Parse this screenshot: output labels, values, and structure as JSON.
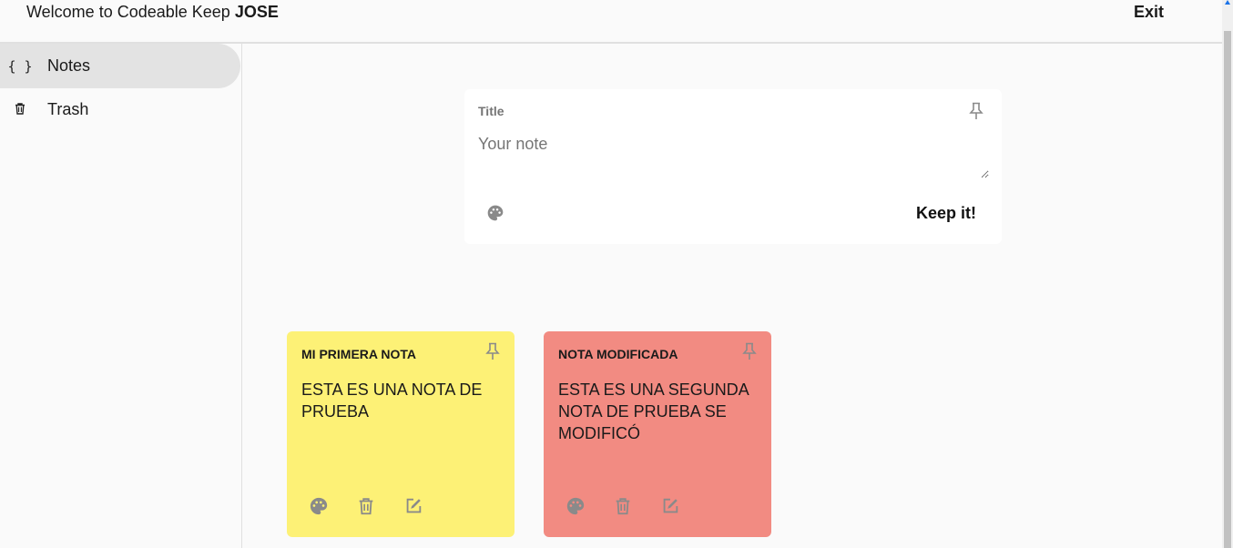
{
  "header": {
    "welcome_text": "Welcome to Codeable Keep ",
    "username": "JOSE",
    "exit_label": "Exit"
  },
  "sidebar": {
    "items": [
      {
        "label": "Notes",
        "icon": "braces-icon",
        "icon_glyph": "{ }",
        "active": true
      },
      {
        "label": "Trash",
        "icon": "trash-icon",
        "active": false
      }
    ]
  },
  "composer": {
    "title_placeholder": "Title",
    "note_placeholder": "Your note",
    "submit_label": "Keep it!"
  },
  "notes": [
    {
      "title": "MI PRIMERA NOTA",
      "body": "ESTA ES UNA NOTA DE PRUEBA",
      "color": "#fdf176"
    },
    {
      "title": "NOTA MODIFICADA",
      "body": "ESTA ES UNA SEGUNDA NOTA DE PRUEBA SE MODIFICÓ",
      "color": "#f28b82"
    }
  ],
  "colors": {
    "background": "#fafafa",
    "active_nav": "#e3e3e3",
    "icon_gray": "#8a8a8a",
    "scroll_arrow": "#1a73e8"
  }
}
